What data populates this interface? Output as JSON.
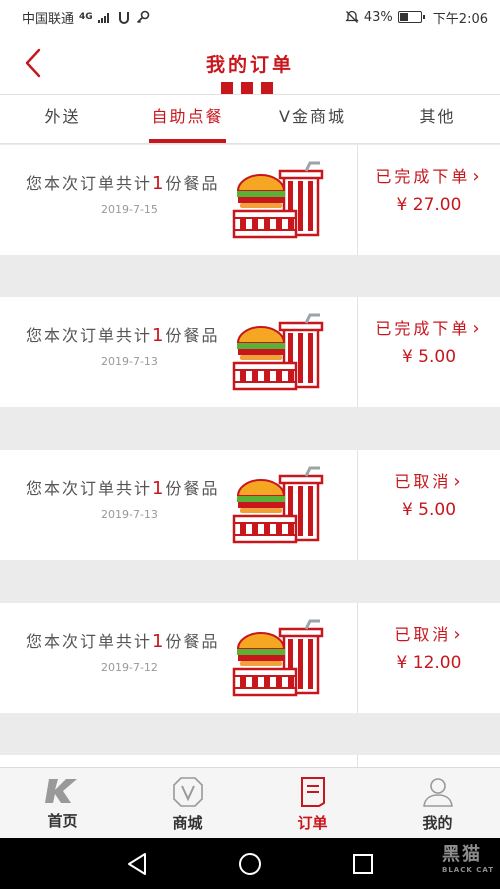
{
  "status_bar": {
    "carrier": "中国联通",
    "network": "4G",
    "battery": "43%",
    "battery_level": 0.43,
    "time": "下午2:06"
  },
  "header": {
    "title": "我的订单"
  },
  "tabs": [
    {
      "label": "外送",
      "active": false
    },
    {
      "label": "自助点餐",
      "active": true
    },
    {
      "label": "V金商城",
      "active": false
    },
    {
      "label": "其他",
      "active": false
    }
  ],
  "orders": [
    {
      "desc_prefix": "您本次订单共计",
      "count": "1",
      "desc_suffix": "份餐品",
      "date": "2019-7-15",
      "status": "已完成下单",
      "price": "¥ 27.00"
    },
    {
      "desc_prefix": "您本次订单共计",
      "count": "1",
      "desc_suffix": "份餐品",
      "date": "2019-7-13",
      "status": "已完成下单",
      "price": "¥ 5.00"
    },
    {
      "desc_prefix": "您本次订单共计",
      "count": "1",
      "desc_suffix": "份餐品",
      "date": "2019-7-13",
      "status": "已取消",
      "price": "¥ 5.00"
    },
    {
      "desc_prefix": "您本次订单共计",
      "count": "1",
      "desc_suffix": "份餐品",
      "date": "2019-7-12",
      "status": "已取消",
      "price": "¥ 12.00"
    }
  ],
  "bottom_nav": [
    {
      "label": "首页",
      "icon": "k-logo-icon",
      "active": false
    },
    {
      "label": "商城",
      "icon": "v-shop-icon",
      "active": false
    },
    {
      "label": "订单",
      "icon": "order-list-icon",
      "active": true
    },
    {
      "label": "我的",
      "icon": "user-icon",
      "active": false
    }
  ],
  "watermark": {
    "text": "黑猫",
    "sub": "BLACK CAT"
  },
  "colors": {
    "accent": "#c8161d",
    "background": "#ebebeb"
  }
}
